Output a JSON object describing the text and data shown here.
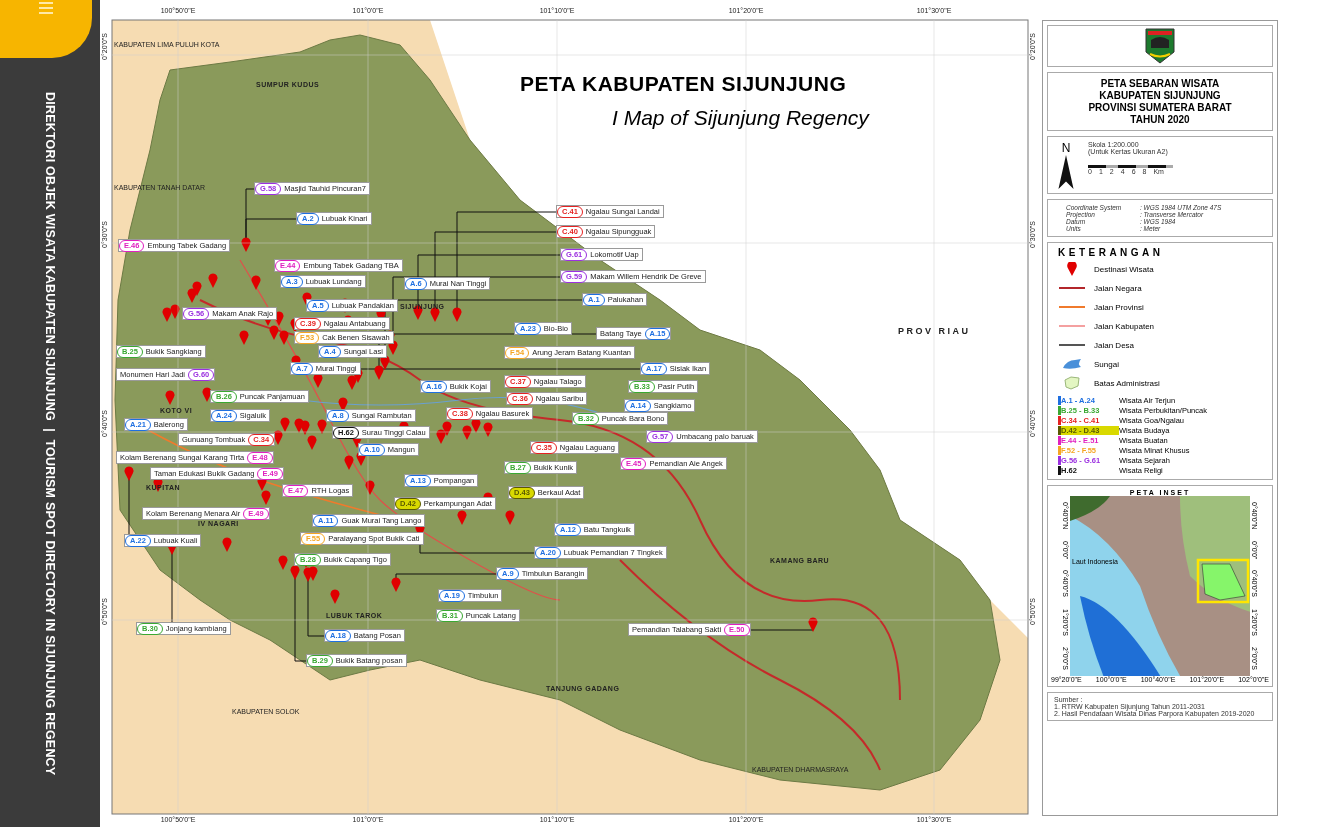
{
  "sidebar": {
    "title": "DIREKTORI OBJEK WISATA KABUPATEN SIJUNJUNG  |  TOURISM SPOT DIRECTORY IN SIJUNJUNG REGENCY"
  },
  "map": {
    "title": "PETA KABUPATEN SIJUNJUNG",
    "subtitle": "I Map of Sijunjung Regency",
    "top_ticks": [
      "100°50'0\"E",
      "101°0'0\"E",
      "101°10'0\"E",
      "101°20'0\"E",
      "101°30'0\"E"
    ],
    "bottom_ticks": [
      "100°50'0\"E",
      "101°0'0\"E",
      "101°10'0\"E",
      "101°20'0\"E",
      "101°30'0\"E"
    ],
    "left_ticks": [
      "0°20'0\"S",
      "0°30'0\"S",
      "0°40'0\"S",
      "0°50'0\"S"
    ],
    "right_ticks": [
      "0°20'0\"S",
      "0°30'0\"S",
      "0°40'0\"S",
      "0°50'0\"S"
    ],
    "regions": [
      "KABUPATEN LIMA PULUH KOTA",
      "SUMPUR KUDUS",
      "KABUPATEN TANAH DATAR",
      "SIJUNJUNG",
      "PROV RIAU",
      "KOTO VI",
      "KUPITAN",
      "IV NAGARI",
      "LUBUK TAROK",
      "KAMANG BARU",
      "TANJUNG GADANG",
      "KABUPATEN SOLOK",
      "KABUPATEN DHARMASRAYA"
    ],
    "destinations": [
      {
        "kind": "code_first",
        "code": "G.58",
        "name": "Masjid Tauhid Pincuran7",
        "color": "#9b30e0"
      },
      {
        "kind": "code_first",
        "code": "A.2",
        "name": "Lubuak Kinari",
        "color": "#1e6fe0"
      },
      {
        "kind": "code_first",
        "code": "E.46",
        "name": "Embung Tabek Gadang",
        "color": "#e020c0"
      },
      {
        "kind": "code_first",
        "code": "E.44",
        "name": "Embung Tabek Gadang TBA",
        "color": "#e020c0"
      },
      {
        "kind": "code_first",
        "code": "A.3",
        "name": "Lubuak Lundang",
        "color": "#1e6fe0"
      },
      {
        "kind": "code_first",
        "code": "A.6",
        "name": "Murai Nan Tinggi",
        "color": "#1e6fe0"
      },
      {
        "kind": "code_first",
        "code": "A.5",
        "name": "Lubuak Pandakian",
        "color": "#1e6fe0"
      },
      {
        "kind": "code_first",
        "code": "G.56",
        "name": "Makam Anak Rajo",
        "color": "#9b30e0"
      },
      {
        "kind": "code_first",
        "code": "C.39",
        "name": "Ngalau Antabuang",
        "color": "#e52222"
      },
      {
        "kind": "code_first",
        "code": "F.53",
        "name": "Cak Benen Sisawah",
        "color": "#f5a623"
      },
      {
        "kind": "code_first",
        "code": "B.25",
        "name": "Bukik Sangkiang",
        "color": "#3aa832"
      },
      {
        "kind": "code_first",
        "code": "A.4",
        "name": "Sungai Lasi",
        "color": "#1e6fe0"
      },
      {
        "kind": "code_first",
        "code": "A.7",
        "name": "Murai Tinggi",
        "color": "#1e6fe0"
      },
      {
        "kind": "name_first",
        "code": "G.60",
        "name": "Monumen Hari Jadi",
        "color": "#9b30e0"
      },
      {
        "kind": "code_first",
        "code": "B.26",
        "name": "Puncak Panjamuan",
        "color": "#3aa832"
      },
      {
        "kind": "code_first",
        "code": "A.24",
        "name": "Sigaluik",
        "color": "#1e6fe0"
      },
      {
        "kind": "code_first",
        "code": "A.21",
        "name": "Balerong",
        "color": "#1e6fe0"
      },
      {
        "kind": "code_first",
        "code": "A.8",
        "name": "Sungai Rambutan",
        "color": "#1e6fe0"
      },
      {
        "kind": "code_first",
        "code": "H.62",
        "name": "Surau Tinggi Calau",
        "color": "#111111"
      },
      {
        "kind": "name_first",
        "code": "C.34",
        "name": "Gunuang Tombuak",
        "color": "#e52222"
      },
      {
        "kind": "code_first",
        "code": "A.10",
        "name": "Mangun",
        "color": "#1e6fe0"
      },
      {
        "kind": "name_first",
        "code": "E.48",
        "name": "Kolam Berenang Sungai Karang Tirta",
        "color": "#e020c0"
      },
      {
        "kind": "name_first",
        "code": "E.49",
        "name": "Taman Edukasi Bukik Gadang",
        "color": "#e020c0"
      },
      {
        "kind": "code_first",
        "code": "E.47",
        "name": "RTH Logas",
        "color": "#e020c0"
      },
      {
        "kind": "name_first",
        "code": "E.49",
        "name": "Kolam Berenang Menara Air",
        "color": "#e020c0"
      },
      {
        "kind": "code_first",
        "code": "A.22",
        "name": "Lubuak Kuali",
        "color": "#1e6fe0"
      },
      {
        "kind": "code_first",
        "code": "A.11",
        "name": "Guak Murai Tang Lango",
        "color": "#1e6fe0"
      },
      {
        "kind": "code_first",
        "code": "F.55",
        "name": "Paralayang Spot Bukik Cati",
        "color": "#f5a623"
      },
      {
        "kind": "code_first",
        "code": "B.28",
        "name": "Bukik Capang Tigo",
        "color": "#3aa832"
      },
      {
        "kind": "code_first",
        "code": "B.30",
        "name": "Jonjang kambiang",
        "color": "#3aa832"
      },
      {
        "kind": "code_first",
        "code": "A.18",
        "name": "Batang Posan",
        "color": "#1e6fe0"
      },
      {
        "kind": "code_first",
        "code": "B.29",
        "name": "Bukik Batang posan",
        "color": "#3aa832"
      },
      {
        "kind": "code_first",
        "code": "C.41",
        "name": "Ngalau Sungai Landai",
        "color": "#e52222"
      },
      {
        "kind": "code_first",
        "code": "C.40",
        "name": "Ngalau Sipungguak",
        "color": "#e52222"
      },
      {
        "kind": "code_first",
        "code": "G.61",
        "name": "Lokomotif Uap",
        "color": "#9b30e0"
      },
      {
        "kind": "code_first",
        "code": "G.59",
        "name": "Makam Willem Hendrik De Greve",
        "color": "#9b30e0"
      },
      {
        "kind": "code_first",
        "code": "A.1",
        "name": "Palukahan",
        "color": "#1e6fe0"
      },
      {
        "kind": "code_first",
        "code": "A.23",
        "name": "Bio-Bio",
        "color": "#1e6fe0"
      },
      {
        "kind": "name_first",
        "code": "A.15",
        "name": "Batang Taye",
        "color": "#1e6fe0"
      },
      {
        "kind": "code_first",
        "code": "F.54",
        "name": "Arung Jeram Batang Kuantan",
        "color": "#f5a623"
      },
      {
        "kind": "code_first",
        "code": "A.17",
        "name": "Sisiak Ikan",
        "color": "#1e6fe0"
      },
      {
        "kind": "code_first",
        "code": "A.16",
        "name": "Bukik Kojai",
        "color": "#1e6fe0"
      },
      {
        "kind": "code_first",
        "code": "C.37",
        "name": "Ngalau Talago",
        "color": "#e52222"
      },
      {
        "kind": "code_first",
        "code": "B.33",
        "name": "Pasir Putih",
        "color": "#3aa832"
      },
      {
        "kind": "code_first",
        "code": "C.36",
        "name": "Ngalau Saribu",
        "color": "#e52222"
      },
      {
        "kind": "code_first",
        "code": "A.14",
        "name": "Sangkiamo",
        "color": "#1e6fe0"
      },
      {
        "kind": "code_first",
        "code": "C.38",
        "name": "Ngalau Basurek",
        "color": "#e52222"
      },
      {
        "kind": "code_first",
        "code": "B.32",
        "name": "Puncak Bara Bono",
        "color": "#3aa832"
      },
      {
        "kind": "code_first",
        "code": "G.57",
        "name": "Umbacang palo baruak",
        "color": "#9b30e0"
      },
      {
        "kind": "code_first",
        "code": "C.35",
        "name": "Ngalau Laguang",
        "color": "#e52222"
      },
      {
        "kind": "code_first",
        "code": "B.27",
        "name": "Bukik Kunik",
        "color": "#3aa832"
      },
      {
        "kind": "code_first",
        "code": "E.45",
        "name": "Pemandian Aie Angek",
        "color": "#e020c0"
      },
      {
        "kind": "code_first",
        "code": "A.13",
        "name": "Pompangan",
        "color": "#1e6fe0"
      },
      {
        "kind": "code_first_highlight",
        "code": "D.43",
        "name": "Berkaul Adat",
        "color": "#5a5a00"
      },
      {
        "kind": "code_first_highlight",
        "code": "D.42",
        "name": "Perkampungan Adat",
        "color": "#5a5a00"
      },
      {
        "kind": "code_first",
        "code": "A.12",
        "name": "Batu Tangkuik",
        "color": "#1e6fe0"
      },
      {
        "kind": "code_first",
        "code": "A.20",
        "name": "Lubuak Pemandian 7 Tingkek",
        "color": "#1e6fe0"
      },
      {
        "kind": "code_first",
        "code": "A.9",
        "name": "Timbulun Barangin",
        "color": "#1e6fe0"
      },
      {
        "kind": "code_first",
        "code": "A.19",
        "name": "Timbulun",
        "color": "#1e6fe0"
      },
      {
        "kind": "code_first",
        "code": "B.31",
        "name": "Puncak Latang",
        "color": "#3aa832"
      },
      {
        "kind": "name_first",
        "code": "E.50",
        "name": "Pemandian Talabang Sakti",
        "color": "#e020c0"
      }
    ]
  },
  "legend": {
    "title_lines": [
      "PETA SEBARAN WISATA",
      "KABUPATEN SIJUNJUNG",
      "PROVINSI SUMATERA BARAT",
      "TAHUN 2020"
    ],
    "north": "N",
    "scale": "Skola 1:200.000",
    "paper": "(Untuk Kertas Ukuran A2)",
    "scale_ticks": [
      "0",
      "1",
      "2",
      "4",
      "6",
      "8"
    ],
    "scale_unit": "Km",
    "projection": [
      {
        "label": "Coordinate System",
        "value": ": WGS 1984 UTM Zone 47S"
      },
      {
        "label": "Projection",
        "value": ": Transverse Mercator"
      },
      {
        "label": "Datum",
        "value": ": WGS 1984"
      },
      {
        "label": "Units",
        "value": ": Meter"
      }
    ],
    "heading": "KETERANGAN",
    "symbols": [
      {
        "kind": "pin",
        "label": "Destinasi Wisata"
      },
      {
        "kind": "line",
        "label": "Jalan Negara",
        "color": "#b3262b"
      },
      {
        "kind": "line",
        "label": "Jalan Provinsi",
        "color": "#f07a2c"
      },
      {
        "kind": "line",
        "label": "Jalan Kabupaten",
        "color": "#f4a0a0"
      },
      {
        "kind": "line",
        "label": "Jalan Desa",
        "color": "#555555"
      },
      {
        "kind": "river",
        "label": "Sungai"
      },
      {
        "kind": "area",
        "label": "Batas Administrasi"
      }
    ],
    "categories": [
      {
        "kind": "plain",
        "range": "A.1 - A.24",
        "label": "Wisata Air Terjun",
        "color": "#1e6fe0"
      },
      {
        "kind": "plain",
        "range": "B.25 - B.33",
        "label": "Wisata Perbukitan/Puncak",
        "color": "#3aa832"
      },
      {
        "kind": "plain",
        "range": "C.34 - C.41",
        "label": "Wisata Goa/Ngalau",
        "color": "#e52222"
      },
      {
        "kind": "highlight",
        "range": "D.42 - D.43",
        "label": "Wisata Budaya",
        "color": "#5a5a00"
      },
      {
        "kind": "plain",
        "range": "E.44 - E.51",
        "label": "Wisata Buatan",
        "color": "#e020c0"
      },
      {
        "kind": "plain",
        "range": "F.52 - F.55",
        "label": "Wisata Minat Khusus",
        "color": "#f5a623"
      },
      {
        "kind": "plain",
        "range": "G.56 - G.61",
        "label": "Wisata Sejarah",
        "color": "#9b30e0"
      },
      {
        "kind": "plain",
        "range": "H.62",
        "label": "Wisata Religi",
        "color": "#111111"
      }
    ],
    "inset": {
      "title": "PETA INSET",
      "sea": "Laut Indonesia",
      "x_ticks": [
        "99°20'0\"E",
        "100°0'0\"E",
        "100°40'0\"E",
        "101°20'0\"E",
        "102°0'0\"E"
      ],
      "left_ticks": [
        "0°40'0\"N",
        "0°0'0\"",
        "0°40'0\"S",
        "1°20'0\"S",
        "2°0'0\"S"
      ],
      "right_ticks": [
        "0°40'0\"N",
        "0°0'0\"",
        "0°40'0\"S",
        "1°20'0\"S",
        "2°0'0\"S"
      ]
    },
    "sources_title": "Sumber :",
    "sources": [
      "1. RTRW Kabupaten Sijunjung Tahun 2011-2031",
      "2. Hasil Pendataan Wisata Dinas Parpora Kabupaten 2019-2020"
    ]
  }
}
